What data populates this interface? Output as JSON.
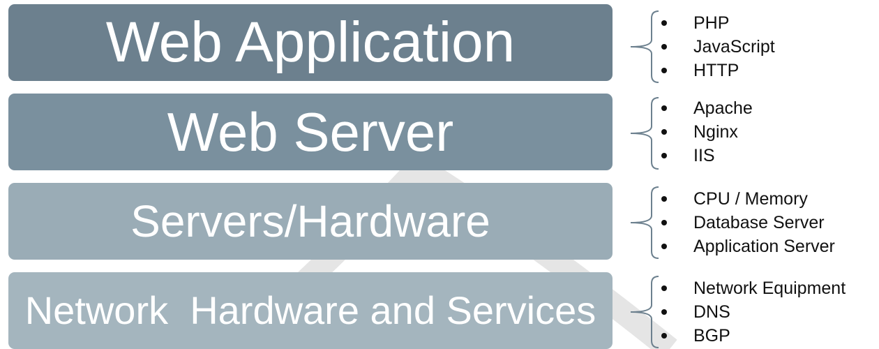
{
  "layers": [
    {
      "label": "Web Application",
      "bullets": [
        "PHP",
        "JavaScript",
        "HTTP"
      ]
    },
    {
      "label": "Web Server",
      "bullets": [
        "Apache",
        "Nginx",
        "IIS"
      ]
    },
    {
      "label": "Servers/Hardware",
      "bullets": [
        "CPU / Memory",
        "Database Server",
        "Application Server"
      ]
    },
    {
      "label": "Network  Hardware and Services",
      "bullets": [
        "Network Equipment",
        "DNS",
        "BGP"
      ]
    }
  ],
  "colors": {
    "layer_1": "#6c808e",
    "layer_2": "#7a909e",
    "layer_3": "#9aacb6",
    "layer_4": "#a4b5be",
    "brace": "#6c808e",
    "text": "#111111"
  }
}
